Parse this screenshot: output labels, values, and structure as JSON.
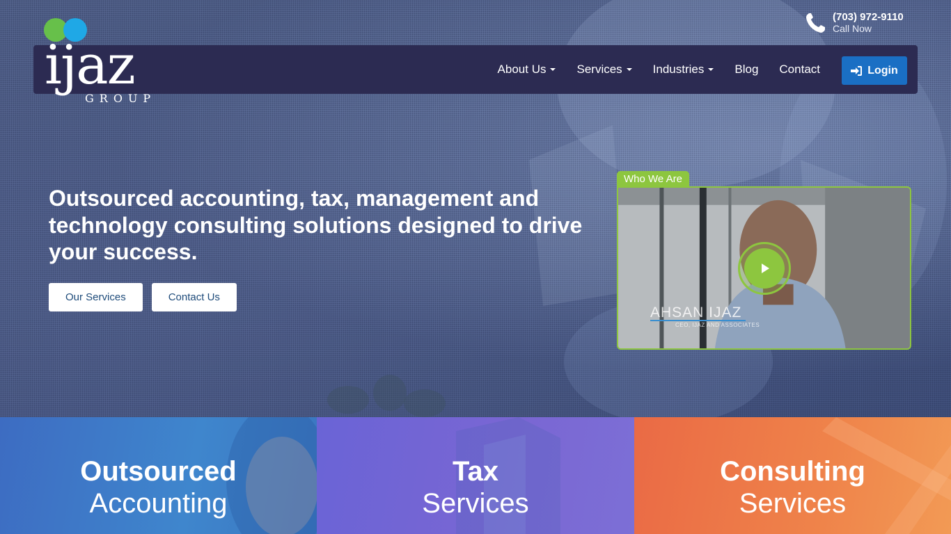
{
  "header": {
    "phone_number": "(703) 972-9110",
    "phone_sub": "Call Now",
    "logo_text": "ijaz",
    "logo_sub": "GROUP",
    "nav": [
      {
        "label": "About Us",
        "dropdown": true
      },
      {
        "label": "Services",
        "dropdown": true
      },
      {
        "label": "Industries",
        "dropdown": true
      },
      {
        "label": "Blog",
        "dropdown": false
      },
      {
        "label": "Contact",
        "dropdown": false
      }
    ],
    "login_label": "Login",
    "icons": {
      "phone": "phone-icon",
      "login": "sign-in-icon",
      "dropdown": "caret-down-icon"
    }
  },
  "hero": {
    "headline": "Outsourced accounting, tax, management and technology consulting solutions designed to drive your success.",
    "buttons": {
      "services": "Our Services",
      "contact": "Contact Us"
    }
  },
  "video": {
    "tab_label": "Who We Are",
    "name": "AHSAN IJAZ",
    "subtitle": "CEO, IJAZ AND ASSOCIATES",
    "play_icon": "play-icon"
  },
  "panels": [
    {
      "title": "Outsourced",
      "sub": "Accounting"
    },
    {
      "title": "Tax",
      "sub": "Services"
    },
    {
      "title": "Consulting",
      "sub": "Services"
    }
  ],
  "colors": {
    "navbar": "#2c2b52",
    "login": "#1a6fc4",
    "accent_green": "#8dc63f",
    "logo_blue": "#1fa8e6",
    "logo_green": "#67c04a",
    "panel_blue": "#3f86cd",
    "panel_purple": "#7a66d3",
    "panel_orange": "#ef834a"
  }
}
